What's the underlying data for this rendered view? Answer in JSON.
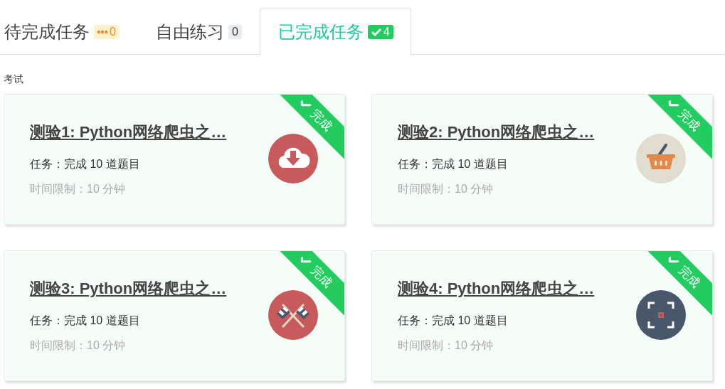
{
  "tabs": [
    {
      "label": "待完成任务",
      "badge": "0",
      "kind": "pending",
      "selected": false
    },
    {
      "label": "自由练习",
      "badge": "0",
      "kind": "plain",
      "selected": false
    },
    {
      "label": "已完成任务",
      "badge": "4",
      "kind": "done",
      "selected": true
    }
  ],
  "section": "考试",
  "cards": [
    {
      "title": "测验1: Python网络爬虫之…",
      "task": "任务：完成 10 道题目",
      "time_limit": "时间限制：10 分钟",
      "kind": "download",
      "completed": true,
      "ribbon": "完成"
    },
    {
      "title": "测验2: Python网络爬虫之…",
      "task": "任务：完成 10 道题目",
      "time_limit": "时间限制：10 分钟",
      "kind": "basket",
      "completed": true,
      "ribbon": "完成"
    },
    {
      "title": "测验3: Python网络爬虫之…",
      "task": "任务：完成 10 道题目",
      "time_limit": "时间限制：10 分钟",
      "kind": "flags",
      "completed": true,
      "ribbon": "完成"
    },
    {
      "title": "测验4: Python网络爬虫之…",
      "task": "任务：完成 10 道题目",
      "time_limit": "时间限制：10 分钟",
      "kind": "target",
      "completed": true,
      "ribbon": "完成"
    }
  ]
}
